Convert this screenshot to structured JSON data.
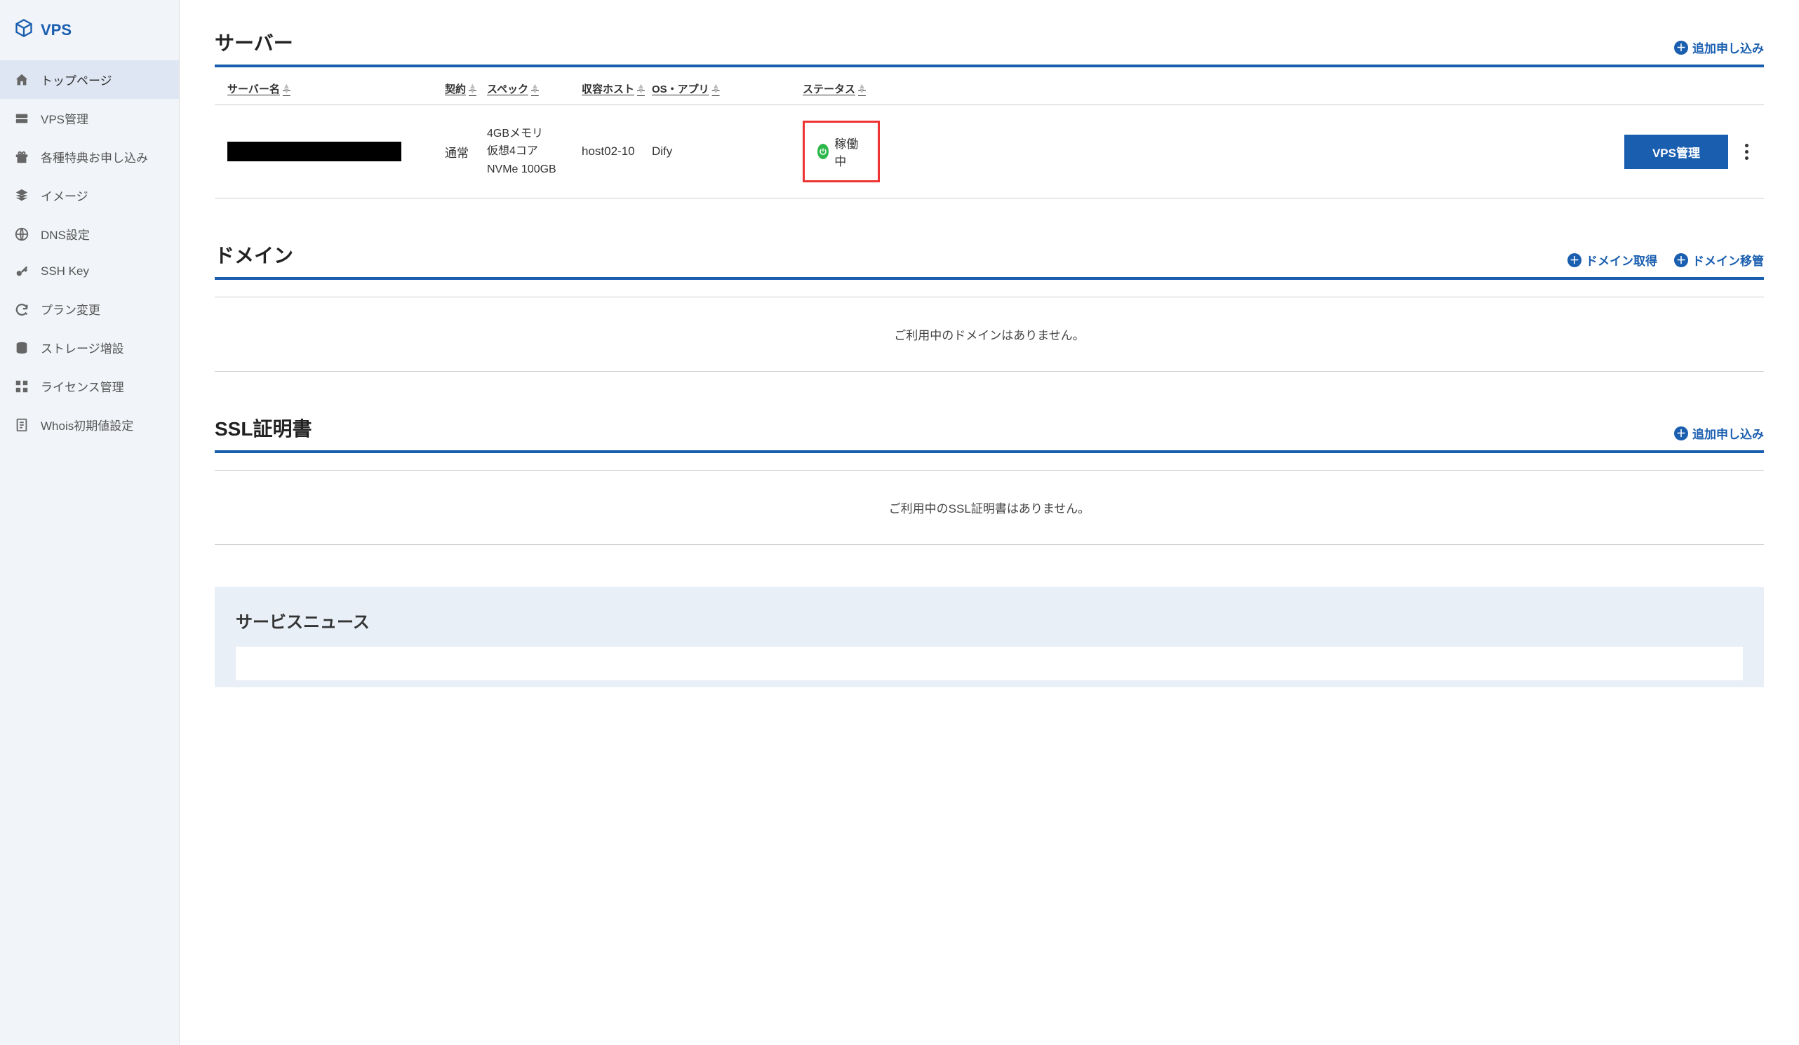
{
  "brand": {
    "label": "VPS"
  },
  "sidebar": {
    "items": [
      {
        "label": "トップページ",
        "icon": "home",
        "active": true
      },
      {
        "label": "VPS管理",
        "icon": "server"
      },
      {
        "label": "各種特典お申し込み",
        "icon": "gift"
      },
      {
        "label": "イメージ",
        "icon": "layers"
      },
      {
        "label": "DNS設定",
        "icon": "globe"
      },
      {
        "label": "SSH Key",
        "icon": "key"
      },
      {
        "label": "プラン変更",
        "icon": "refresh"
      },
      {
        "label": "ストレージ増設",
        "icon": "database"
      },
      {
        "label": "ライセンス管理",
        "icon": "grid"
      },
      {
        "label": "Whois初期値設定",
        "icon": "document"
      }
    ]
  },
  "sections": {
    "server": {
      "title": "サーバー",
      "add_label": "追加申し込み",
      "columns": {
        "name": "サーバー名",
        "contract": "契約",
        "spec": "スペック",
        "host": "収容ホスト",
        "os": "OS・アプリ",
        "status": "ステータス"
      },
      "rows": [
        {
          "contract": "通常",
          "spec_lines": [
            "4GBメモリ",
            "仮想4コア",
            "NVMe 100GB"
          ],
          "host": "host02-10",
          "os": "Dify",
          "status": "稼働中",
          "action_label": "VPS管理"
        }
      ]
    },
    "domain": {
      "title": "ドメイン",
      "actions": [
        "ドメイン取得",
        "ドメイン移管"
      ],
      "empty": "ご利用中のドメインはありません。"
    },
    "ssl": {
      "title": "SSL証明書",
      "add_label": "追加申し込み",
      "empty": "ご利用中のSSL証明書はありません。"
    },
    "news": {
      "title": "サービスニュース"
    }
  }
}
